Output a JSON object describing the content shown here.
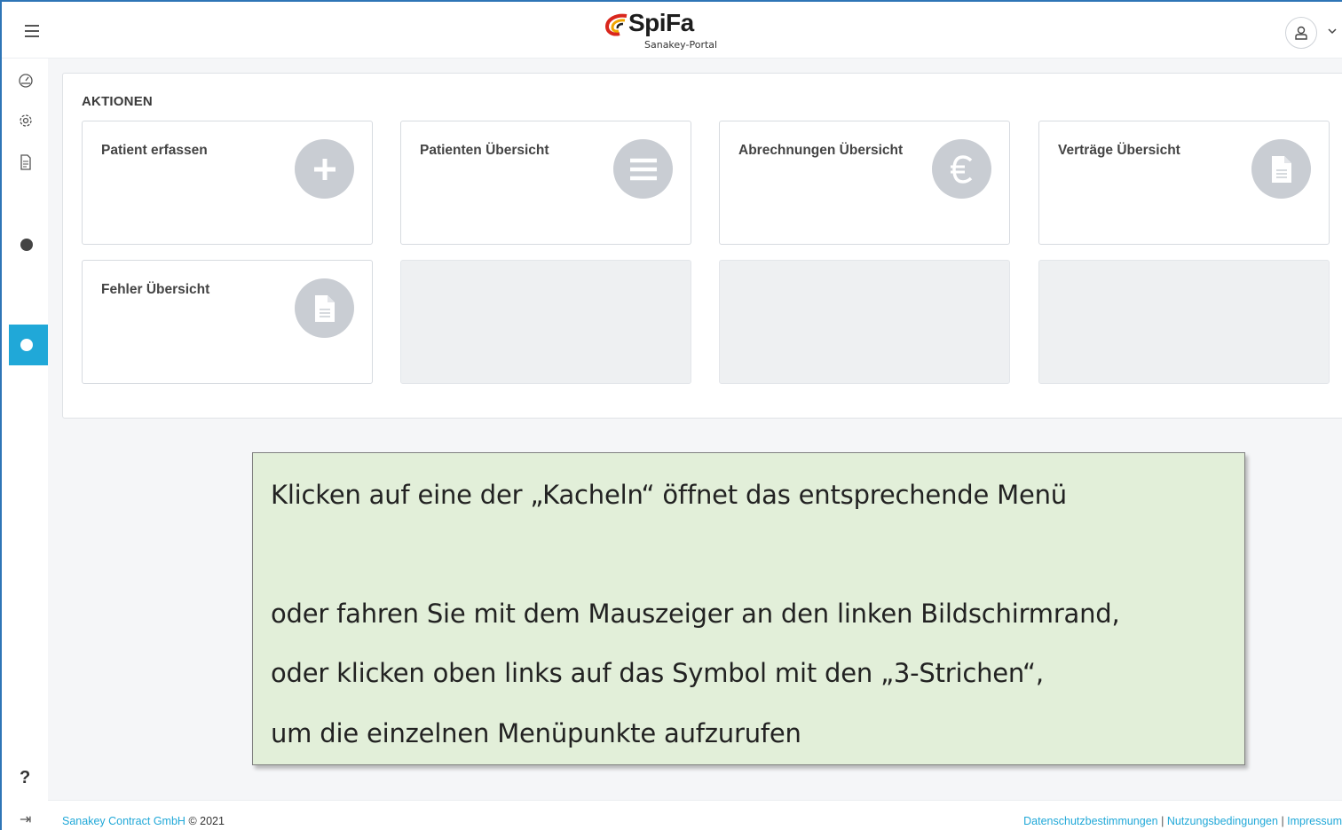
{
  "header": {
    "logo_text": "SpiFa",
    "logo_subtitle": "Sanakey-Portal",
    "user_chevron": "⌄"
  },
  "sidebar": {
    "help_label": "?",
    "logout_label": "⇥"
  },
  "main": {
    "section_title": "AKTIONEN",
    "tiles": [
      {
        "label": "Patient erfassen",
        "icon": "plus-icon"
      },
      {
        "label": "Patienten Übersicht",
        "icon": "list-icon"
      },
      {
        "label": "Abrechnungen Übersicht",
        "icon": "euro-icon"
      },
      {
        "label": "Verträge Übersicht",
        "icon": "document-icon"
      },
      {
        "label": "Fehler Übersicht",
        "icon": "document-icon"
      }
    ]
  },
  "callout": {
    "line1": "Klicken auf eine der „Kacheln“ öffnet das entsprechende Menü",
    "line2": "oder fahren Sie mit dem Mauszeiger an den linken Bildschirmrand,",
    "line3": "oder klicken oben links auf das Symbol mit den „3-Strichen“,",
    "line4": "um die einzelnen Menüpunkte aufzurufen"
  },
  "footer": {
    "company": "Sanakey Contract GmbH",
    "copyright": "© 2021",
    "link_privacy": "Datenschutzbestimmungen",
    "link_terms": "Nutzungsbedingungen",
    "link_imprint": "Impressum",
    "separator": "|"
  },
  "colors": {
    "accent": "#20a8d8",
    "callout_bg": "#e2efd9",
    "tile_icon_bg": "#c9cdd3"
  }
}
